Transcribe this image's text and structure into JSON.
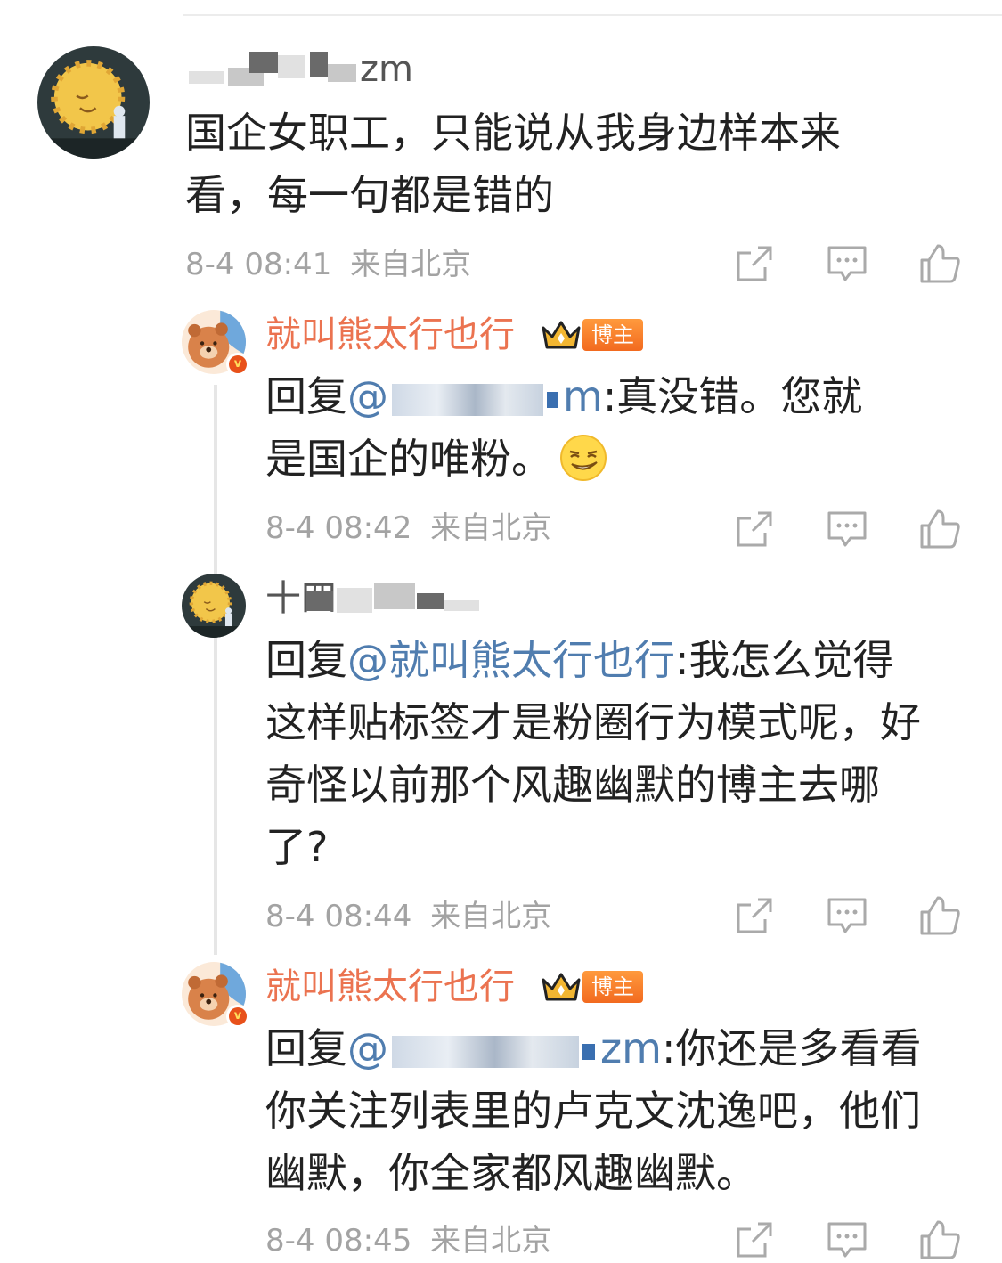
{
  "comments": [
    {
      "username": "zm",
      "text_lines": [
        "国企女职工，只能说从我身边样本来",
        "看，每一句都是错的"
      ],
      "time": "8-4 08:41",
      "location": "来自北京"
    },
    {
      "username": "就叫熊太行也行",
      "badge": "博主",
      "reply_prefix": "回复",
      "mention": "@ m",
      "text_after": ":真没错。您就",
      "text_line2": "是国企的唯粉。",
      "time": "8-4 08:42",
      "location": "来自北京"
    },
    {
      "username": "十四",
      "reply_prefix": "回复",
      "mention": "@就叫熊太行也行",
      "text_after": ":我怎么觉得",
      "text_lines": [
        "这样贴标签才是粉圈行为模式呢，好",
        "奇怪以前那个风趣幽默的博主去哪",
        "了?"
      ],
      "time": "8-4 08:44",
      "location": "来自北京"
    },
    {
      "username": "就叫熊太行也行",
      "badge": "博主",
      "reply_prefix": "回复",
      "mention": "@ zm",
      "text_after": ":你还是多看看",
      "text_lines": [
        "你关注列表里的卢克文沈逸吧，他们",
        "幽默，你全家都风趣幽默。"
      ],
      "time": "8-4 08:45",
      "location": "来自北京"
    }
  ],
  "icons": {
    "share": "share-icon",
    "reply": "comment-icon",
    "like": "like-icon",
    "verified": "verified-v-icon",
    "crown": "crown-icon",
    "emoji": "smirk-emoji-icon"
  },
  "colors": {
    "username_blogger": "#eb7350",
    "mention": "#507daf",
    "meta": "#a3a3a3",
    "badge": "#f26a1f"
  }
}
